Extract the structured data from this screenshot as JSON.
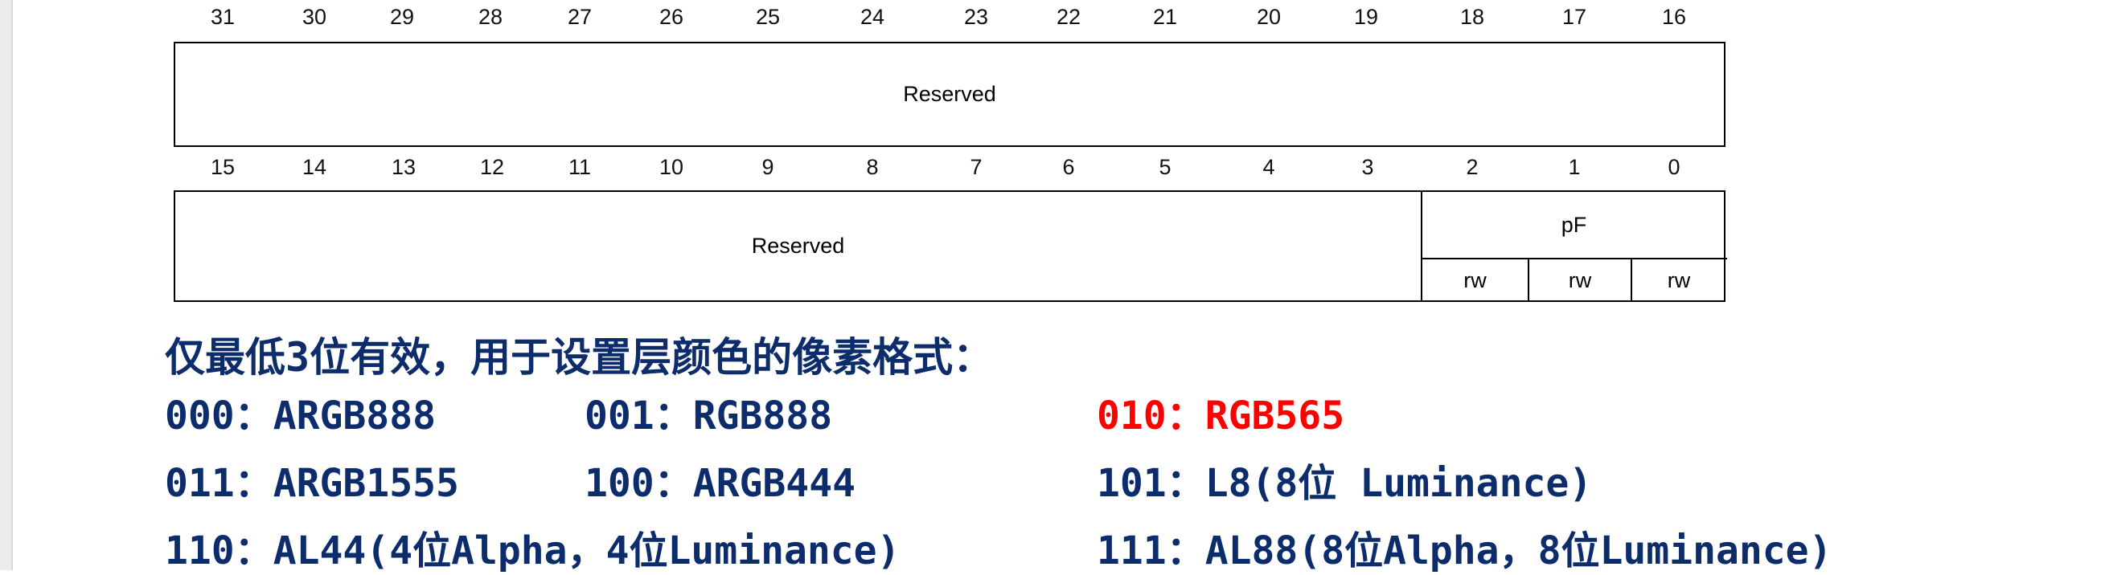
{
  "top_row": {
    "bit_numbers": [
      "31",
      "30",
      "29",
      "28",
      "27",
      "26",
      "25",
      "24",
      "23",
      "22",
      "21",
      "20",
      "19",
      "18",
      "17",
      "16"
    ],
    "field_label": "Reserved"
  },
  "bottom_row": {
    "bit_numbers": [
      "15",
      "14",
      "13",
      "12",
      "11",
      "10",
      "9",
      "8",
      "7",
      "6",
      "5",
      "4",
      "3",
      "2",
      "1",
      "0"
    ],
    "reserved_label": "Reserved",
    "pf_label": "pF",
    "access": [
      "rw",
      "rw",
      "rw"
    ]
  },
  "description": {
    "heading": "仅最低3位有效，用于设置层颜色的像素格式：",
    "formats": [
      {
        "text": "000：ARGB888",
        "highlight": false
      },
      {
        "text": "001：RGB888",
        "highlight": false
      },
      {
        "text": "010：RGB565",
        "highlight": true
      },
      {
        "text": "011：ARGB1555",
        "highlight": false
      },
      {
        "text": "100：ARGB444",
        "highlight": false
      },
      {
        "text": "101：L8(8位 Luminance)",
        "highlight": false
      },
      {
        "text": "110：AL44(4位Alpha，4位Luminance)",
        "highlight": false
      },
      {
        "text": "111：AL88(8位Alpha，8位Luminance)",
        "highlight": false
      }
    ],
    "highlight_color": "#ff0000",
    "text_color": "#0d2c6b"
  }
}
